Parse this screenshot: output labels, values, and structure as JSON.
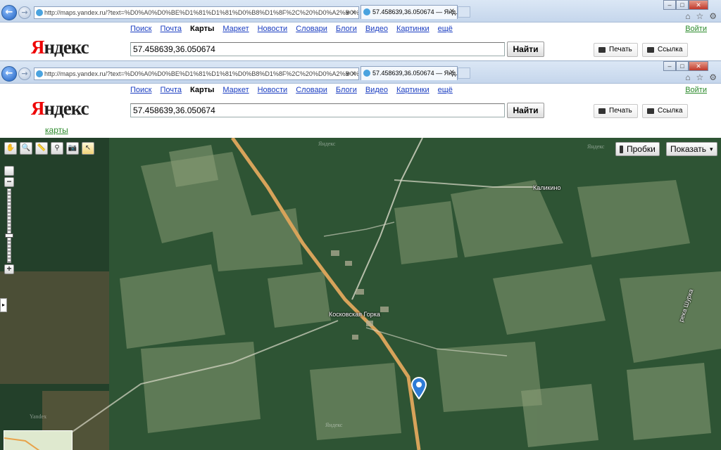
{
  "browser": {
    "back_label": "←",
    "forward_label": "→",
    "address": "http://maps.yandex.ru/?text=%D0%A0%D0%BE%D1%81%D1%81%D0%B8%D1%8F%2C%20%D0%A2%D0%B2%D0%B5%D1%80%D1%81",
    "address_ctrl": "▾ ✕",
    "tab_title": "57.458639,36.050674 — Янд...",
    "tab_close": "✕",
    "window_controls": [
      "–",
      "□",
      "✕"
    ],
    "tool_icons": [
      "⌂",
      "☆",
      "⚙"
    ]
  },
  "yandex": {
    "logo_first": "Я",
    "logo_rest": "ндекс",
    "nav_links": [
      "Поиск",
      "Почта",
      "Карты",
      "Маркет",
      "Новости",
      "Словари",
      "Блоги",
      "Видео",
      "Картинки",
      "ещё"
    ],
    "current_link": "Карты",
    "login": "Войти",
    "search_value": "57.458639,36.050674",
    "find_button": "Найти",
    "print_button": "Печать",
    "link_button": "Ссылка",
    "service_label": "карты"
  },
  "map": {
    "tools": [
      "✋",
      "🔍",
      "📏",
      "⚲",
      "📷",
      "↖"
    ],
    "zoom_in": "+",
    "zoom_out": "−",
    "expander": "▸",
    "traffic_button": "Пробки",
    "show_button": "Показать",
    "show_arrow": "▾",
    "labels": {
      "village_center": "Косковская Горка",
      "village_ne": "Каликино",
      "river": "река Шурка"
    },
    "watermarks": [
      "Яндекс",
      "Яндекс",
      "Яндекс",
      "Yandex"
    ],
    "icons": {
      "pin": "map-pin-icon",
      "colors": {
        "forest": "#2f5535",
        "field": "#7a8c6a",
        "road": "#d9a85b",
        "pin": "#2e7bd6"
      }
    }
  }
}
